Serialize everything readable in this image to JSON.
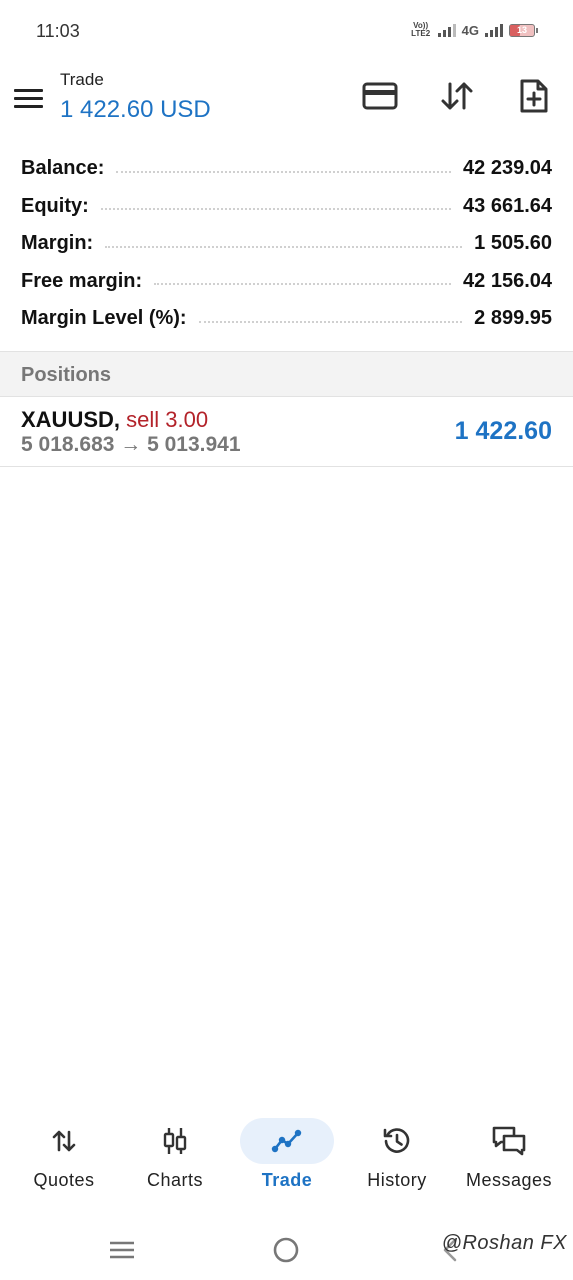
{
  "status_bar": {
    "time": "11:03",
    "volte": "Vo)) LTE2",
    "network": "4G",
    "battery": "13"
  },
  "header": {
    "title": "Trade",
    "subtitle": "1 422.60 USD",
    "icons": [
      "menu-icon",
      "card-icon",
      "sort-icon",
      "new-order-icon"
    ]
  },
  "summary": [
    {
      "label": "Balance:",
      "value": "42 239.04"
    },
    {
      "label": "Equity:",
      "value": "43 661.64"
    },
    {
      "label": "Margin:",
      "value": "1 505.60"
    },
    {
      "label": "Free margin:",
      "value": "42 156.04"
    },
    {
      "label": "Margin Level (%):",
      "value": "2 899.95"
    }
  ],
  "positions": {
    "header": "Positions",
    "items": [
      {
        "symbol": "XAUUSD,",
        "side": "sell 3.00",
        "prices": "5 018.683 → 5 013.941",
        "profit": "1 422.60"
      }
    ]
  },
  "nav": {
    "items": [
      {
        "label": "Quotes",
        "icon": "quotes-icon"
      },
      {
        "label": "Charts",
        "icon": "charts-icon"
      },
      {
        "label": "Trade",
        "icon": "trade-icon",
        "active": true
      },
      {
        "label": "History",
        "icon": "history-icon"
      },
      {
        "label": "Messages",
        "icon": "messages-icon"
      }
    ]
  },
  "watermark": "@Roshan FX",
  "colors": {
    "accent": "#1e73c4",
    "sell": "#b3232a",
    "muted": "#777777"
  }
}
